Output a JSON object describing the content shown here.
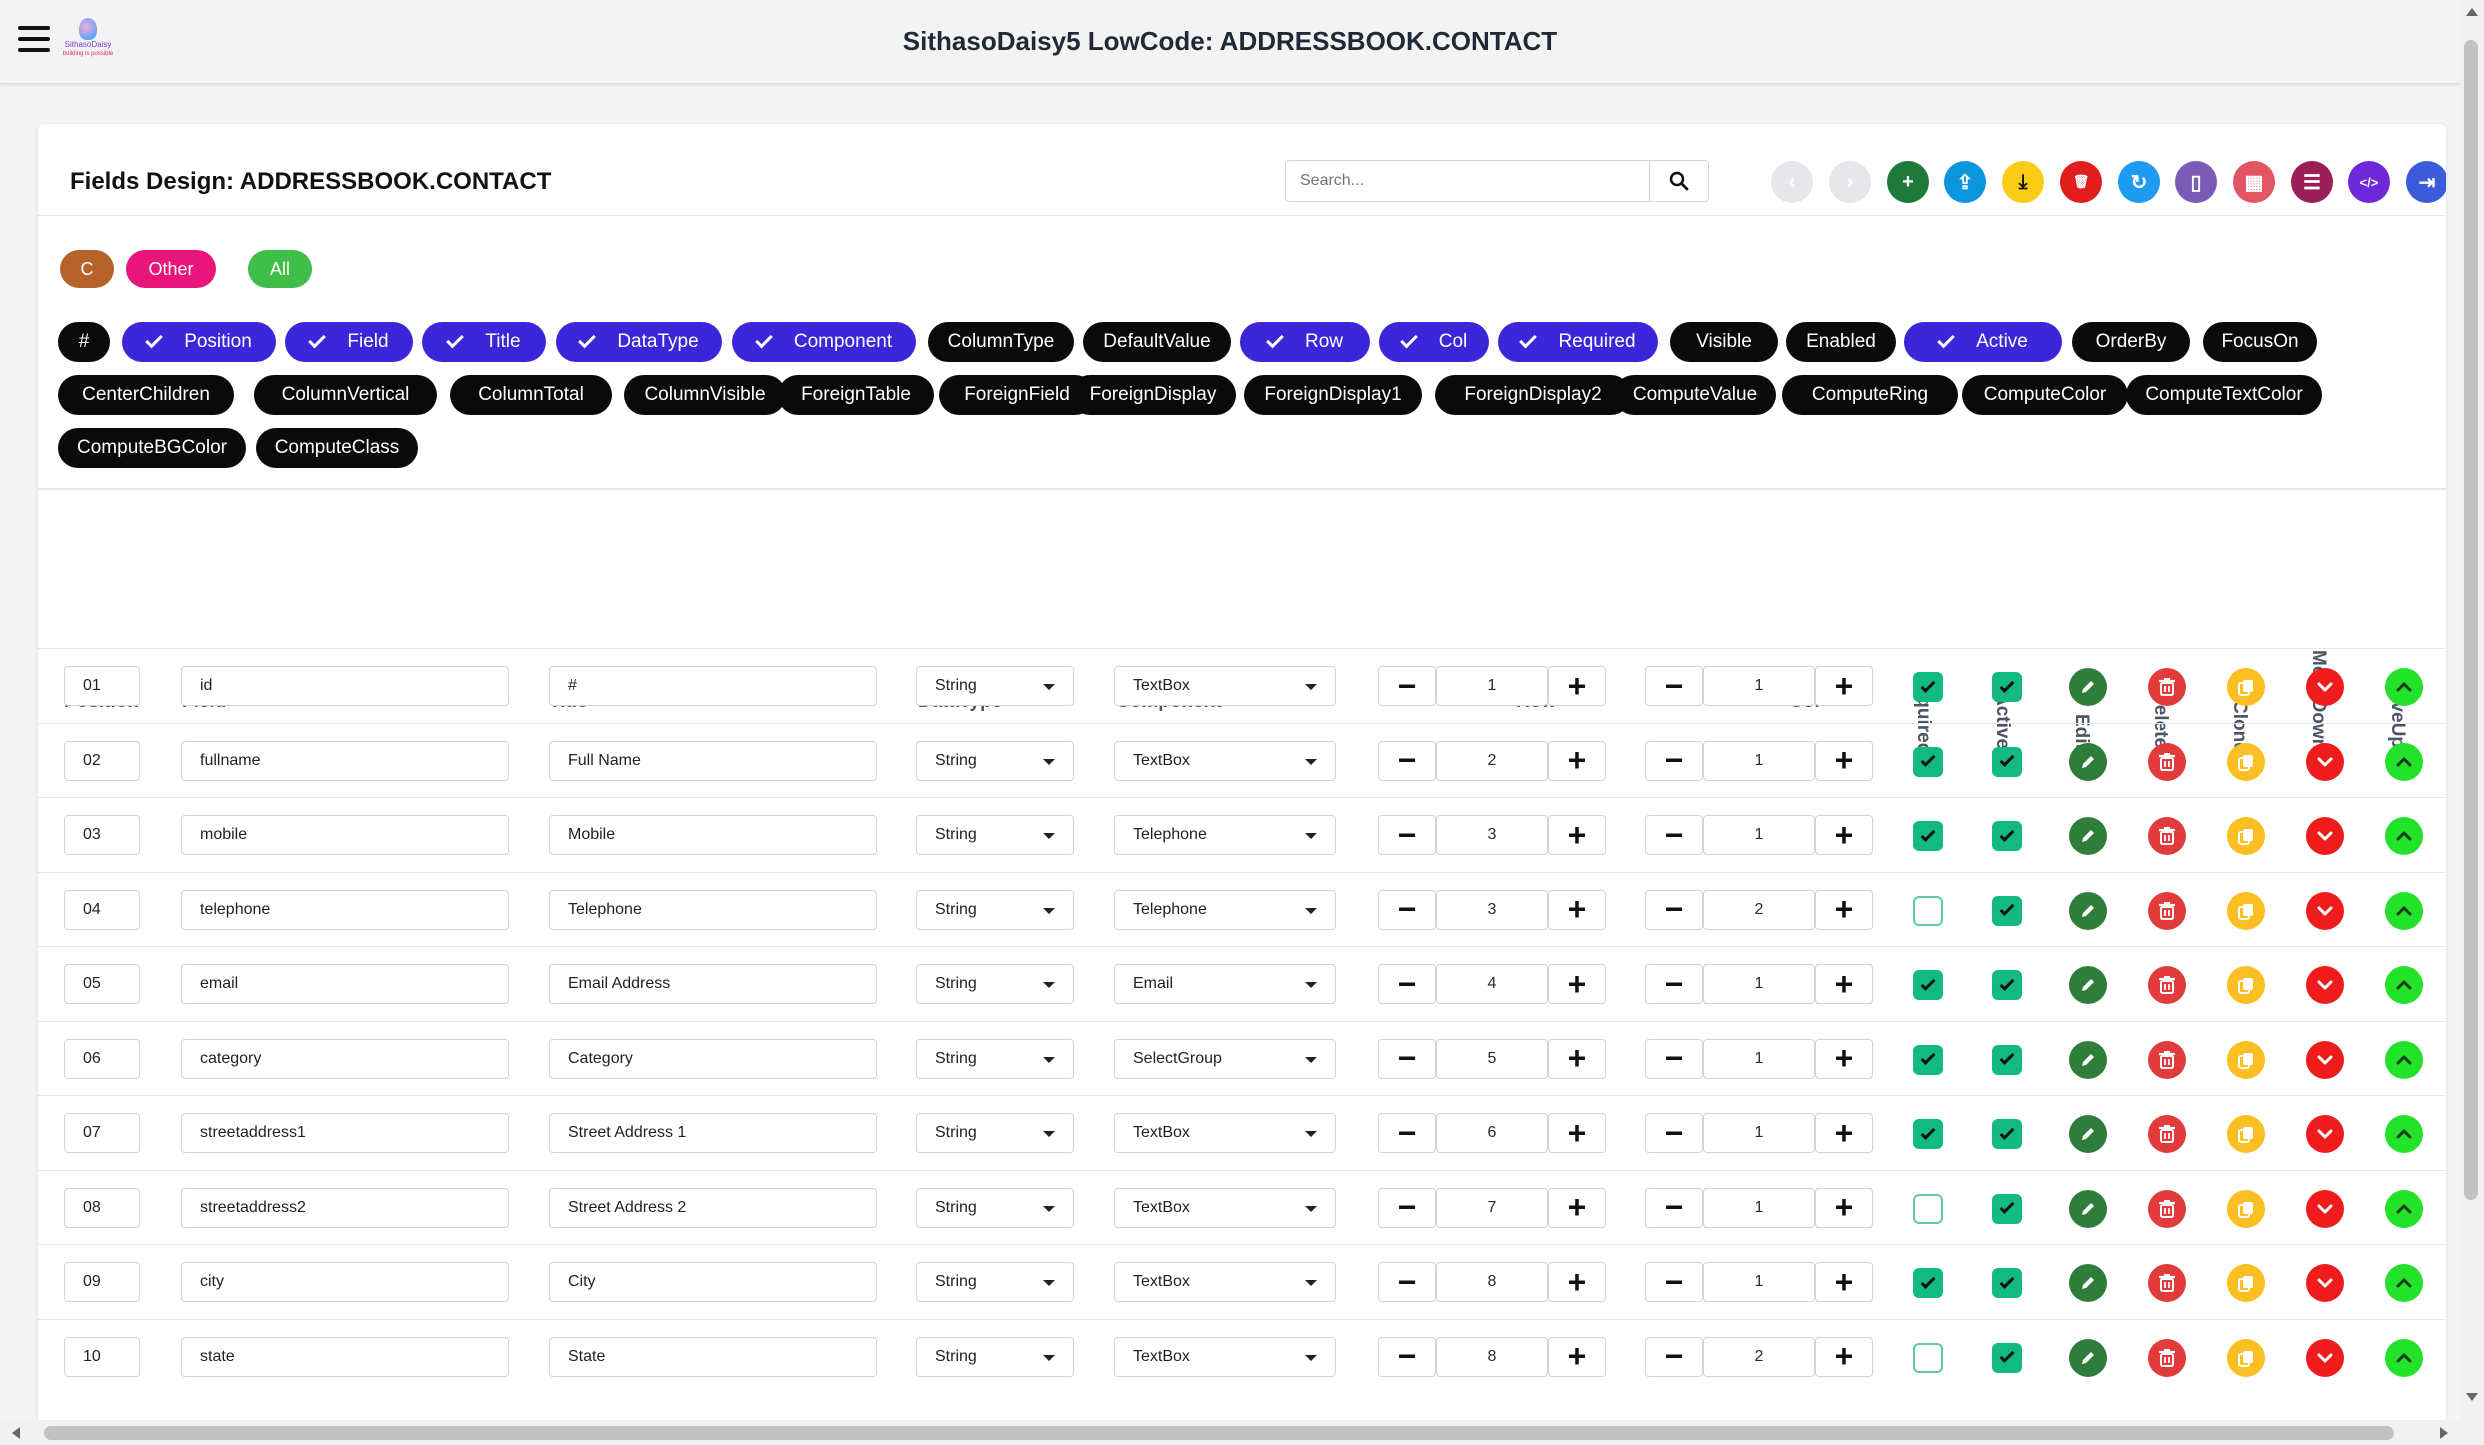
{
  "app": {
    "title": "SithasoDaisy5 LowCode: ADDRESSBOOK.CONTACT",
    "logo_name": "SithasoDaisy",
    "logo_tag": "building is possible"
  },
  "card": {
    "title": "Fields Design: ADDRESSBOOK.CONTACT",
    "search_placeholder": "Search..."
  },
  "toolbar": [
    {
      "name": "back-button",
      "icon": "chevron-left-icon",
      "color": "#e5e7eb",
      "glyph": "‹"
    },
    {
      "name": "forward-button",
      "icon": "chevron-right-icon",
      "color": "#e5e7eb",
      "glyph": "›"
    },
    {
      "name": "add-button",
      "icon": "plus-icon",
      "color": "#1f7a3a",
      "glyph": "+"
    },
    {
      "name": "upload-button",
      "icon": "upload-icon",
      "color": "#0b95dc",
      "glyph": "⇪"
    },
    {
      "name": "download-button",
      "icon": "download-icon",
      "color": "#facc15",
      "glyph": "⤓"
    },
    {
      "name": "delete-all-button",
      "icon": "trash-icon",
      "color": "#e11d1d",
      "glyph": "🗑"
    },
    {
      "name": "refresh-button",
      "icon": "refresh-icon",
      "color": "#1c9bf0",
      "glyph": "↻"
    },
    {
      "name": "mobile-preview-button",
      "icon": "mobile-icon",
      "color": "#7b5bb6",
      "glyph": "▯"
    },
    {
      "name": "grid-button",
      "icon": "grid-icon",
      "color": "#e25563",
      "glyph": "▦"
    },
    {
      "name": "table-button",
      "icon": "table-icon",
      "color": "#9a1f58",
      "glyph": "☰"
    },
    {
      "name": "code-button",
      "icon": "code-icon",
      "color": "#6d28d9",
      "glyph": "</>"
    },
    {
      "name": "exit-button",
      "icon": "sign-out-icon",
      "color": "#3b5bdb",
      "glyph": "⇥"
    }
  ],
  "filter_chips": [
    {
      "label": "C",
      "color": "#b5632b"
    },
    {
      "label": "Other",
      "color": "#e8157a"
    },
    {
      "label": "All",
      "color": "#3fbf4a"
    }
  ],
  "column_pills": [
    {
      "label": "#",
      "selected": false
    },
    {
      "label": "Position",
      "selected": true
    },
    {
      "label": "Field",
      "selected": true
    },
    {
      "label": "Title",
      "selected": true
    },
    {
      "label": "DataType",
      "selected": true
    },
    {
      "label": "Component",
      "selected": true
    },
    {
      "label": "ColumnType",
      "selected": false
    },
    {
      "label": "DefaultValue",
      "selected": false
    },
    {
      "label": "Row",
      "selected": true
    },
    {
      "label": "Col",
      "selected": true
    },
    {
      "label": "Required",
      "selected": true
    },
    {
      "label": "Visible",
      "selected": false
    },
    {
      "label": "Enabled",
      "selected": false
    },
    {
      "label": "Active",
      "selected": true
    },
    {
      "label": "OrderBy",
      "selected": false
    },
    {
      "label": "FocusOn",
      "selected": false
    },
    {
      "label": "CenterChildren",
      "selected": false
    },
    {
      "label": "ColumnVertical",
      "selected": false
    },
    {
      "label": "ColumnTotal",
      "selected": false
    },
    {
      "label": "ColumnVisible",
      "selected": false
    },
    {
      "label": "ForeignTable",
      "selected": false
    },
    {
      "label": "ForeignField",
      "selected": false
    },
    {
      "label": "ForeignDisplay",
      "selected": false
    },
    {
      "label": "ForeignDisplay1",
      "selected": false
    },
    {
      "label": "ForeignDisplay2",
      "selected": false
    },
    {
      "label": "ComputeValue",
      "selected": false
    },
    {
      "label": "ComputeRing",
      "selected": false
    },
    {
      "label": "ComputeColor",
      "selected": false
    },
    {
      "label": "ComputeTextColor",
      "selected": false
    },
    {
      "label": "ComputeBGColor",
      "selected": false
    },
    {
      "label": "ComputeClass",
      "selected": false
    }
  ],
  "table": {
    "headers": {
      "position": "Position",
      "field": "Field",
      "title": "Title",
      "datatype": "DataType",
      "component": "Component",
      "row": "Row",
      "col": "Col",
      "required": "Required",
      "active": "Active",
      "edit": "Edit",
      "delete": "Delete",
      "clone": "Clone",
      "movedown": "MoveDown",
      "moveup": "MoveUp"
    },
    "rows": [
      {
        "position": "01",
        "field": "id",
        "title": "#",
        "datatype": "String",
        "component": "TextBox",
        "row": "1",
        "col": "1",
        "required": true,
        "active": true
      },
      {
        "position": "02",
        "field": "fullname",
        "title": "Full Name",
        "datatype": "String",
        "component": "TextBox",
        "row": "2",
        "col": "1",
        "required": true,
        "active": true
      },
      {
        "position": "03",
        "field": "mobile",
        "title": "Mobile",
        "datatype": "String",
        "component": "Telephone",
        "row": "3",
        "col": "1",
        "required": true,
        "active": true
      },
      {
        "position": "04",
        "field": "telephone",
        "title": "Telephone",
        "datatype": "String",
        "component": "Telephone",
        "row": "3",
        "col": "2",
        "required": false,
        "active": true
      },
      {
        "position": "05",
        "field": "email",
        "title": "Email Address",
        "datatype": "String",
        "component": "Email",
        "row": "4",
        "col": "1",
        "required": true,
        "active": true
      },
      {
        "position": "06",
        "field": "category",
        "title": "Category",
        "datatype": "String",
        "component": "SelectGroup",
        "row": "5",
        "col": "1",
        "required": true,
        "active": true
      },
      {
        "position": "07",
        "field": "streetaddress1",
        "title": "Street Address 1",
        "datatype": "String",
        "component": "TextBox",
        "row": "6",
        "col": "1",
        "required": true,
        "active": true
      },
      {
        "position": "08",
        "field": "streetaddress2",
        "title": "Street Address 2",
        "datatype": "String",
        "component": "TextBox",
        "row": "7",
        "col": "1",
        "required": false,
        "active": true
      },
      {
        "position": "09",
        "field": "city",
        "title": "City",
        "datatype": "String",
        "component": "TextBox",
        "row": "8",
        "col": "1",
        "required": true,
        "active": true
      },
      {
        "position": "10",
        "field": "state",
        "title": "State",
        "datatype": "String",
        "component": "TextBox",
        "row": "8",
        "col": "2",
        "required": false,
        "active": true
      }
    ]
  },
  "colors": {
    "selected_pill": "#3b27d9",
    "unselected_pill": "#0a0a0a",
    "checkbox_on": "#12b981",
    "edit": "#2f7d3a",
    "delete": "#e23b3b",
    "clone": "#fbbf24",
    "movedown": "#ee1c1c",
    "moveup": "#22e22a"
  }
}
